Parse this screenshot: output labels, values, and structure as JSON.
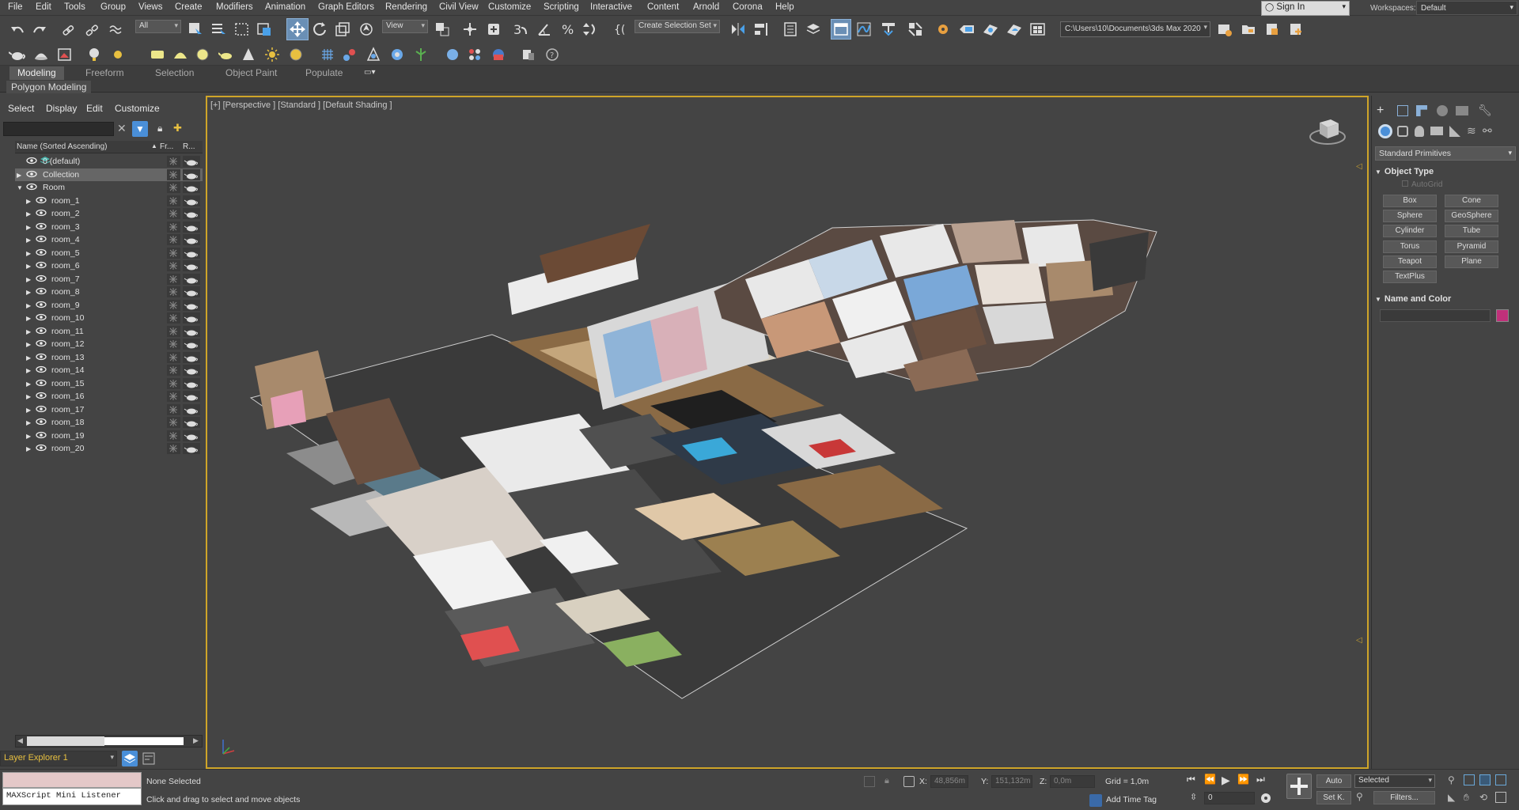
{
  "menu": [
    "File",
    "Edit",
    "Tools",
    "Group",
    "Views",
    "Create",
    "Modifiers",
    "Animation",
    "Graph Editors",
    "Rendering",
    "Civil View",
    "Customize",
    "Scripting",
    "Interactive",
    "Content",
    "Arnold",
    "Corona",
    "Help"
  ],
  "sign_in": "Sign In",
  "workspaces_label": "Workspaces:",
  "workspaces_value": "Default",
  "toolbar": {
    "filter_value": "All",
    "refcoord_value": "View",
    "selection_set": "Create Selection Set",
    "project_path": "C:\\Users\\10\\Documents\\3ds Max 2020"
  },
  "ribbon": {
    "tabs": [
      "Modeling",
      "Freeform",
      "Selection",
      "Object Paint",
      "Populate"
    ],
    "active_tab": "Modeling",
    "panel": "Polygon Modeling"
  },
  "explorer": {
    "menu": [
      "Select",
      "Display",
      "Edit",
      "Customize"
    ],
    "col_name": "Name (Sorted Ascending)",
    "col_frozen": "Fr...",
    "col_render": "R...",
    "rows": [
      {
        "label": "0 (default)",
        "level": 1,
        "expand": ""
      },
      {
        "label": "Collection",
        "level": 1,
        "expand": "▶",
        "selected": true
      },
      {
        "label": "Room",
        "level": 0,
        "expand": "▼"
      },
      {
        "label": "room_1",
        "level": 2,
        "expand": "▶"
      },
      {
        "label": "room_2",
        "level": 2,
        "expand": "▶"
      },
      {
        "label": "room_3",
        "level": 2,
        "expand": "▶"
      },
      {
        "label": "room_4",
        "level": 2,
        "expand": "▶"
      },
      {
        "label": "room_5",
        "level": 2,
        "expand": "▶"
      },
      {
        "label": "room_6",
        "level": 2,
        "expand": "▶"
      },
      {
        "label": "room_7",
        "level": 2,
        "expand": "▶"
      },
      {
        "label": "room_8",
        "level": 2,
        "expand": "▶"
      },
      {
        "label": "room_9",
        "level": 2,
        "expand": "▶"
      },
      {
        "label": "room_10",
        "level": 2,
        "expand": "▶"
      },
      {
        "label": "room_11",
        "level": 2,
        "expand": "▶"
      },
      {
        "label": "room_12",
        "level": 2,
        "expand": "▶"
      },
      {
        "label": "room_13",
        "level": 2,
        "expand": "▶"
      },
      {
        "label": "room_14",
        "level": 2,
        "expand": "▶"
      },
      {
        "label": "room_15",
        "level": 2,
        "expand": "▶"
      },
      {
        "label": "room_16",
        "level": 2,
        "expand": "▶"
      },
      {
        "label": "room_17",
        "level": 2,
        "expand": "▶"
      },
      {
        "label": "room_18",
        "level": 2,
        "expand": "▶"
      },
      {
        "label": "room_19",
        "level": 2,
        "expand": "▶"
      },
      {
        "label": "room_20",
        "level": 2,
        "expand": "▶"
      }
    ],
    "layer_explorer": "Layer Explorer 1"
  },
  "viewport": {
    "label": "[+] [Perspective ] [Standard ] [Default Shading ]"
  },
  "command_panel": {
    "category": "Standard Primitives",
    "object_type_title": "Object Type",
    "autogrid": "AutoGrid",
    "buttons": [
      "Box",
      "Cone",
      "Sphere",
      "GeoSphere",
      "Cylinder",
      "Tube",
      "Torus",
      "Pyramid",
      "Teapot",
      "Plane",
      "TextPlus"
    ],
    "name_color_title": "Name and Color",
    "color": "#c0307a"
  },
  "status": {
    "maxscript": "MAXScript Mini Listener",
    "selection": "None Selected",
    "prompt": "Click and drag to select and move objects",
    "x_label": "X:",
    "x_value": "48,856m",
    "y_label": "Y:",
    "y_value": "151,132m",
    "z_label": "Z:",
    "z_value": "0,0m",
    "grid": "Grid = 1,0m",
    "add_time_tag": "Add Time Tag",
    "auto": "Auto",
    "set_k": "Set K.",
    "key_mode": "Selected",
    "filters": "Filters...",
    "frame": "0"
  }
}
